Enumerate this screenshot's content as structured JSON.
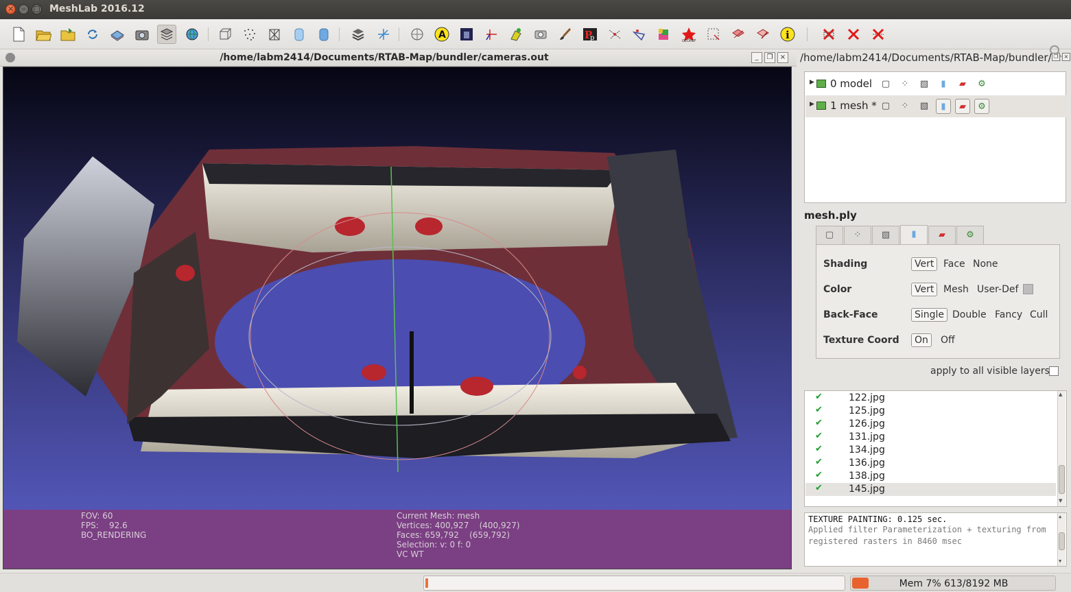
{
  "window": {
    "title": "MeshLab 2016.12",
    "close_glyph": "×",
    "min_glyph": "–",
    "max_glyph": "□"
  },
  "toolbar": {
    "icons": [
      "new-project-icon",
      "open-project-icon",
      "open-mesh-icon",
      "reload-icon",
      "save-snapshot-icon",
      "camera-snapshot-icon",
      "layers-icon",
      "globe-icon",
      "bounding-box-icon",
      "points-icon",
      "wireframe-icon",
      "flat-shading-icon",
      "smooth-shading-icon",
      "layer-stack-icon",
      "axis-icon",
      "trackball-icon",
      "annotation-a-icon",
      "texture-icon",
      "measure-icon",
      "color-paint-icon",
      "camera-icon",
      "brush-icon",
      "pdf-icon",
      "align-icon",
      "decorate-icon",
      "select-faces-icon",
      "georef-icon",
      "select-region-icon",
      "move-icon",
      "zoom-select-icon",
      "info-icon",
      "delete-faces-icon",
      "delete-vertices-icon",
      "delete-all-icon"
    ]
  },
  "mdi": {
    "title": "/home/labm2414/Documents/RTAB-Map/bundler/cameras.out",
    "min": "_",
    "restore": "❐",
    "close": "×"
  },
  "viewport": {
    "left_info": [
      "FOV: 60",
      "FPS:    92.6",
      "BO_RENDERING"
    ],
    "right_info": [
      "Current Mesh: mesh",
      "Vertices: 400,927    (400,927)",
      "Faces: 659,792    (659,792)",
      "Selection: v: 0 f: 0",
      "VC WT"
    ]
  },
  "right_panel": {
    "title": "/home/labm2414/Documents/RTAB-Map/bundler/..."
  },
  "layers": [
    {
      "label": "0  model",
      "selected": false
    },
    {
      "label": "1  mesh *",
      "selected": true
    }
  ],
  "mesh_name": "mesh.ply",
  "render": {
    "shading": {
      "label": "Shading",
      "options": [
        "Vert",
        "Face",
        "None"
      ]
    },
    "color": {
      "label": "Color",
      "options": [
        "Vert",
        "Mesh",
        "User-Def"
      ]
    },
    "backface": {
      "label": "Back-Face",
      "options": [
        "Single",
        "Double",
        "Fancy",
        "Cull"
      ]
    },
    "texcoord": {
      "label": "Texture Coord",
      "options": [
        "On",
        "Off"
      ]
    },
    "user_def_color": "#bdbdbd"
  },
  "apply_label": "apply to all visible layers",
  "rasters": [
    "122.jpg",
    "125.jpg",
    "126.jpg",
    "131.jpg",
    "134.jpg",
    "136.jpg",
    "138.jpg",
    "145.jpg"
  ],
  "check_glyph": "✔",
  "log": {
    "line1": "TEXTURE PAINTING: 0.125 sec.",
    "line2": "Applied filter Parameterization + texturing from registered rasters in 8460 msec"
  },
  "status": {
    "memory": "Mem 7% 613/8192 MB",
    "memory_fraction": 0.07
  }
}
